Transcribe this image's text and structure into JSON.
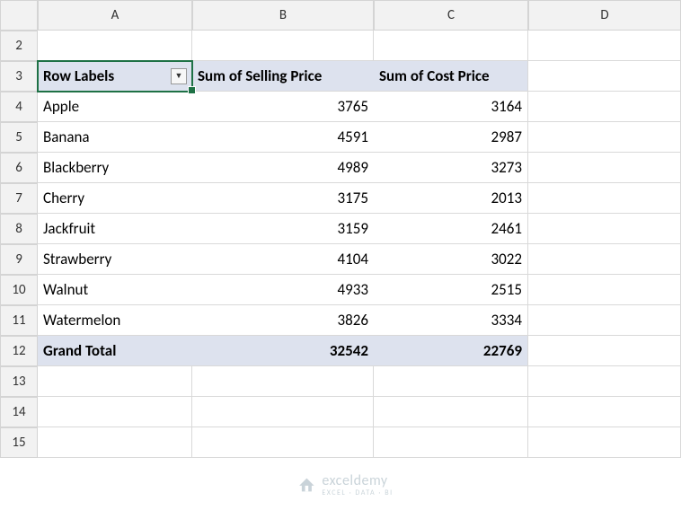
{
  "columns": [
    "A",
    "B",
    "C",
    "D"
  ],
  "rows_visible": [
    2,
    3,
    4,
    5,
    6,
    7,
    8,
    9,
    10,
    11,
    12,
    13,
    14,
    15
  ],
  "selected_cell": "A3",
  "pivot": {
    "headers": {
      "row_labels": "Row Labels",
      "col_b": "Sum of Selling Price",
      "col_c": "Sum of Cost Price"
    },
    "rows": [
      {
        "label": "Apple",
        "b": "3765",
        "c": "3164"
      },
      {
        "label": "Banana",
        "b": "4591",
        "c": "2987"
      },
      {
        "label": "Blackberry",
        "b": "4989",
        "c": "3273"
      },
      {
        "label": "Cherry",
        "b": "3175",
        "c": "2013"
      },
      {
        "label": "Jackfruit",
        "b": "3159",
        "c": "2461"
      },
      {
        "label": "Strawberry",
        "b": "4104",
        "c": "3022"
      },
      {
        "label": "Walnut",
        "b": "4933",
        "c": "2515"
      },
      {
        "label": "Watermelon",
        "b": "3826",
        "c": "3334"
      }
    ],
    "total": {
      "label": "Grand Total",
      "b": "32542",
      "c": "22769"
    }
  },
  "watermark": {
    "name": "exceldemy",
    "tagline": "EXCEL · DATA · BI"
  }
}
